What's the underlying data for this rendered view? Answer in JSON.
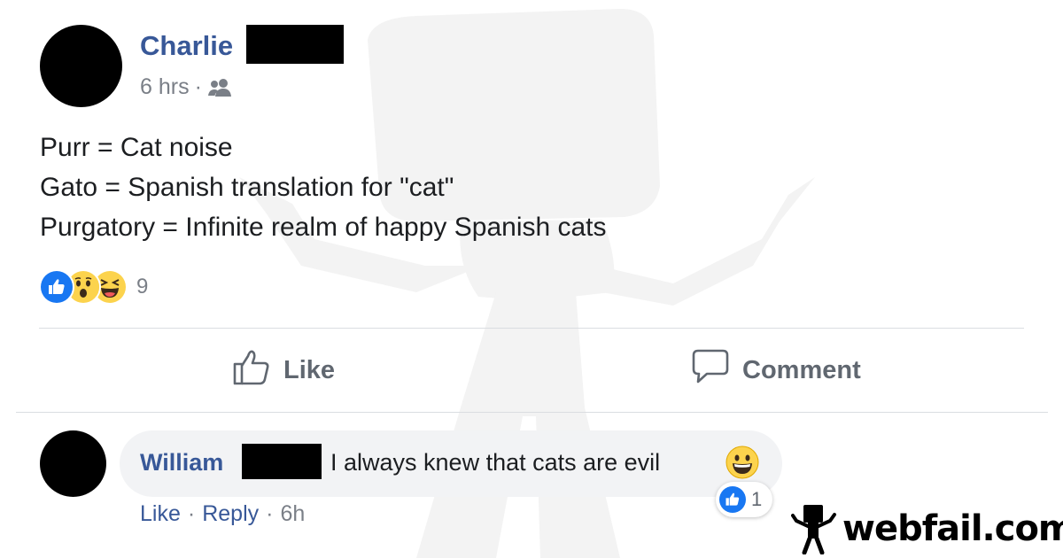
{
  "post": {
    "author": "Charlie",
    "time": "6 hrs",
    "separator": "·",
    "audience_icon": "friends-icon",
    "lines": [
      "Purr = Cat noise",
      "Gato = Spanish translation for \"cat\"",
      "Purgatory = Infinite realm of happy Spanish cats"
    ],
    "reactions": [
      "like",
      "wow",
      "haha"
    ],
    "reaction_count": "9"
  },
  "actions": {
    "like_label": "Like",
    "comment_label": "Comment"
  },
  "comment": {
    "author": "William",
    "text": "I always knew that cats are evil",
    "emoji": "grinning-face",
    "reaction_count": "1",
    "like_label": "Like",
    "reply_label": "Reply",
    "separator": "·",
    "time": "6h"
  },
  "watermark": {
    "site": "webfail.com"
  },
  "colors": {
    "link_blue": "#385898",
    "meta_gray": "#7a7f87",
    "like_blue": "#1877f2",
    "emoji_yellow": "#fcd34d"
  }
}
